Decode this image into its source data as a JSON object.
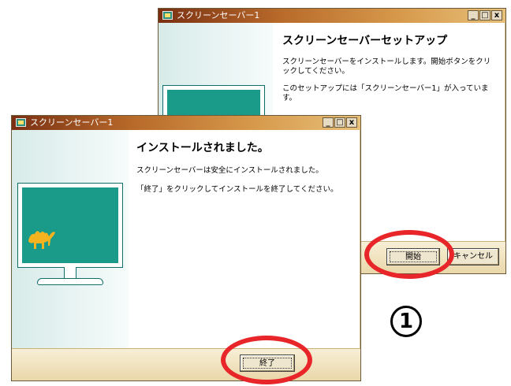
{
  "back_window": {
    "title": "スクリーンセーバー1",
    "heading": "スクリーンセーバーセットアップ",
    "line1": "スクリーンセーバーをインストールします。開始ボタンをクリックしてください。",
    "line2": "このセットアップには「スクリーンセーバー1」が入っています。",
    "start_button": "開始",
    "cancel_button": "キャンセル"
  },
  "front_window": {
    "title": "スクリーンセーバー1",
    "heading": "インストールされました。",
    "line1": "スクリーンセーバーは安全にインストールされました。",
    "line2": "「終了」をクリックしてインストールを終了してください。",
    "finish_button": "終了"
  },
  "title_buttons": {
    "minimize": "_",
    "maximize": "□",
    "close": "x"
  },
  "step_marker": "1",
  "colors": {
    "titlebar_start": "#7a2f12",
    "titlebar_end": "#e7c07a",
    "screen": "#1a9b8a",
    "highlight": "#e8262a"
  },
  "icons": [
    "window-app-icon",
    "monitor-illustration",
    "camel-icon"
  ]
}
